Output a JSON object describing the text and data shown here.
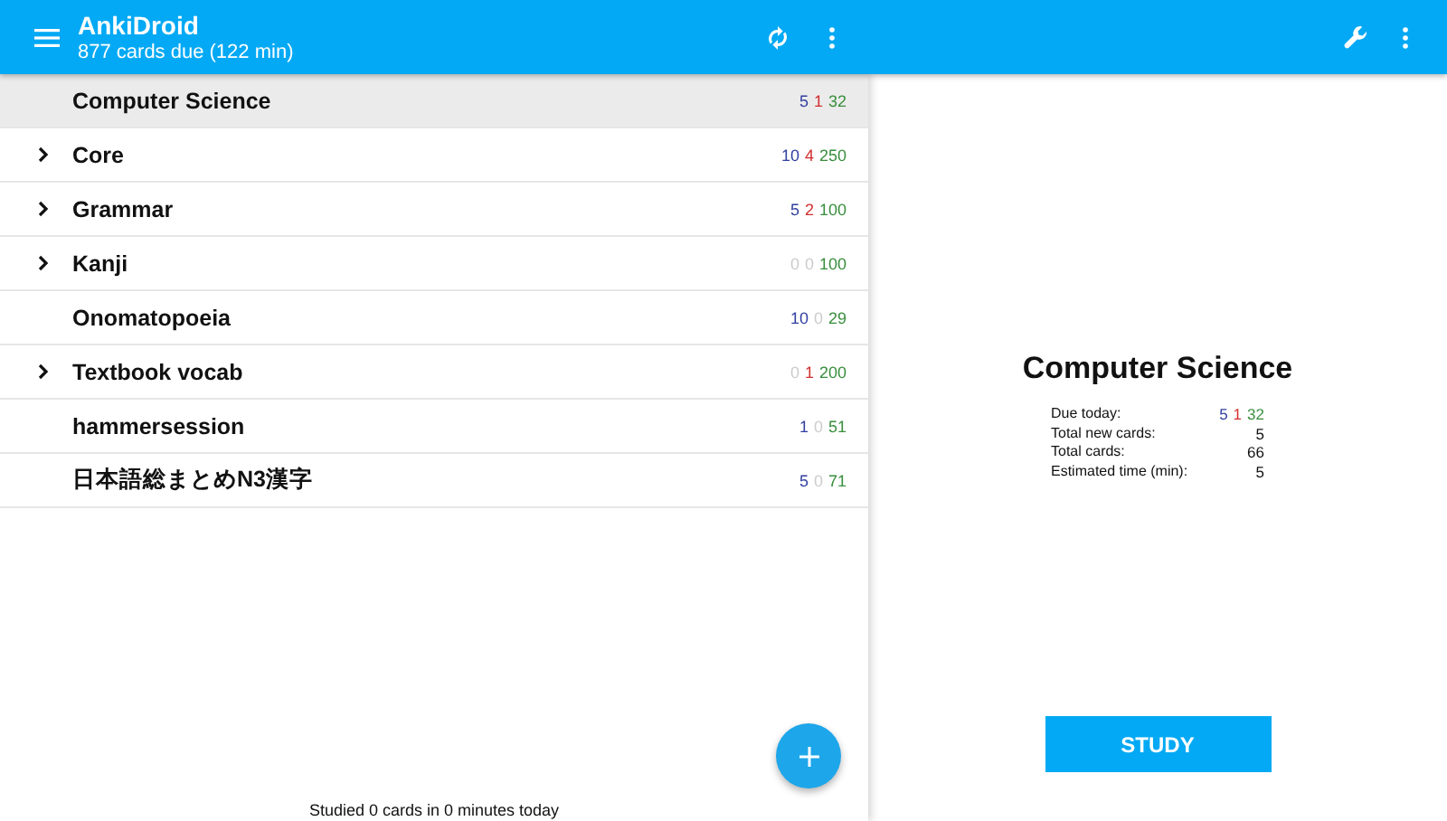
{
  "app_bar": {
    "title": "AnkiDroid",
    "subtitle": "877 cards due (122 min)"
  },
  "decks": [
    {
      "name": "Computer Science",
      "expandable": false,
      "selected": true,
      "counts": [
        {
          "value": "5",
          "dimmed": false
        },
        {
          "value": "1",
          "dimmed": false
        },
        {
          "value": "32",
          "dimmed": false
        }
      ]
    },
    {
      "name": "Core",
      "expandable": true,
      "selected": false,
      "counts": [
        {
          "value": "10",
          "dimmed": false
        },
        {
          "value": "4",
          "dimmed": false
        },
        {
          "value": "250",
          "dimmed": false
        }
      ]
    },
    {
      "name": "Grammar",
      "expandable": true,
      "selected": false,
      "counts": [
        {
          "value": "5",
          "dimmed": false
        },
        {
          "value": "2",
          "dimmed": false
        },
        {
          "value": "100",
          "dimmed": false
        }
      ]
    },
    {
      "name": "Kanji",
      "expandable": true,
      "selected": false,
      "counts": [
        {
          "value": "0",
          "dimmed": true
        },
        {
          "value": "0",
          "dimmed": true
        },
        {
          "value": "100",
          "dimmed": false
        }
      ]
    },
    {
      "name": "Onomatopoeia",
      "expandable": false,
      "selected": false,
      "counts": [
        {
          "value": "10",
          "dimmed": false
        },
        {
          "value": "0",
          "dimmed": true
        },
        {
          "value": "29",
          "dimmed": false
        }
      ]
    },
    {
      "name": "Textbook vocab",
      "expandable": true,
      "selected": false,
      "counts": [
        {
          "value": "0",
          "dimmed": true
        },
        {
          "value": "1",
          "dimmed": false
        },
        {
          "value": "200",
          "dimmed": false
        }
      ]
    },
    {
      "name": "hammersession",
      "expandable": false,
      "selected": false,
      "counts": [
        {
          "value": "1",
          "dimmed": false
        },
        {
          "value": "0",
          "dimmed": true
        },
        {
          "value": "51",
          "dimmed": false
        }
      ]
    },
    {
      "name": "日本語総まとめN3漢字",
      "expandable": false,
      "selected": false,
      "counts": [
        {
          "value": "5",
          "dimmed": false
        },
        {
          "value": "0",
          "dimmed": true
        },
        {
          "value": "71",
          "dimmed": false
        }
      ]
    }
  ],
  "status": "Studied 0 cards in 0 minutes today",
  "detail": {
    "title": "Computer Science",
    "due_label": "Due today:",
    "due_counts": [
      {
        "value": "5",
        "dimmed": false
      },
      {
        "value": "1",
        "dimmed": false
      },
      {
        "value": "32",
        "dimmed": false
      }
    ],
    "stats": [
      {
        "label": "Total new cards:",
        "value": "5"
      },
      {
        "label": "Total cards:",
        "value": "66"
      },
      {
        "label": "Estimated time (min):",
        "value": "5"
      }
    ],
    "study_button": "STUDY"
  }
}
